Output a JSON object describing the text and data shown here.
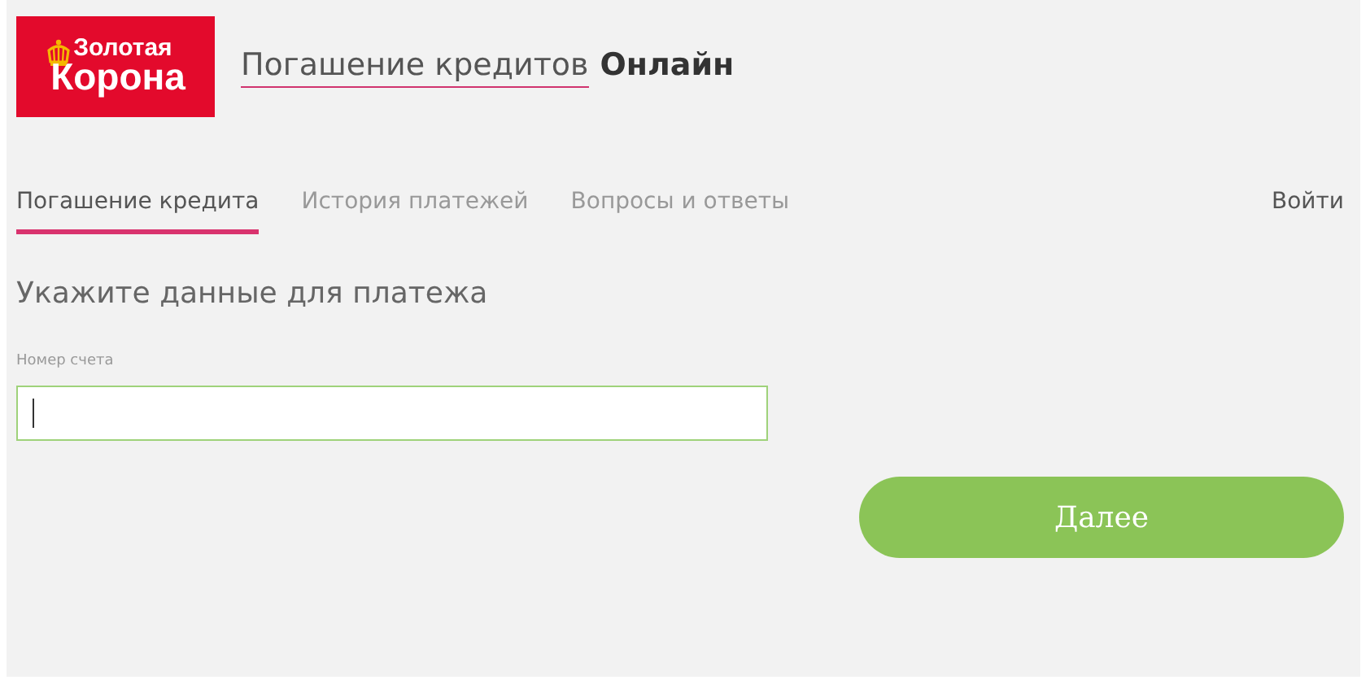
{
  "logo": {
    "line_1": "Золотая",
    "line_2": "Корона"
  },
  "header": {
    "title": "Погашение кредитов",
    "title_suffix": "Онлайн"
  },
  "tabs": [
    {
      "label": "Погашение кредита",
      "selected": true
    },
    {
      "label": "История платежей",
      "selected": false
    },
    {
      "label": "Вопросы и ответы",
      "selected": false
    }
  ],
  "login_link": "Войти",
  "form": {
    "heading": "Укажите данные для платежа",
    "field_label": "Номер счета",
    "focused": true
  },
  "buttons": [
    "Далее"
  ]
}
